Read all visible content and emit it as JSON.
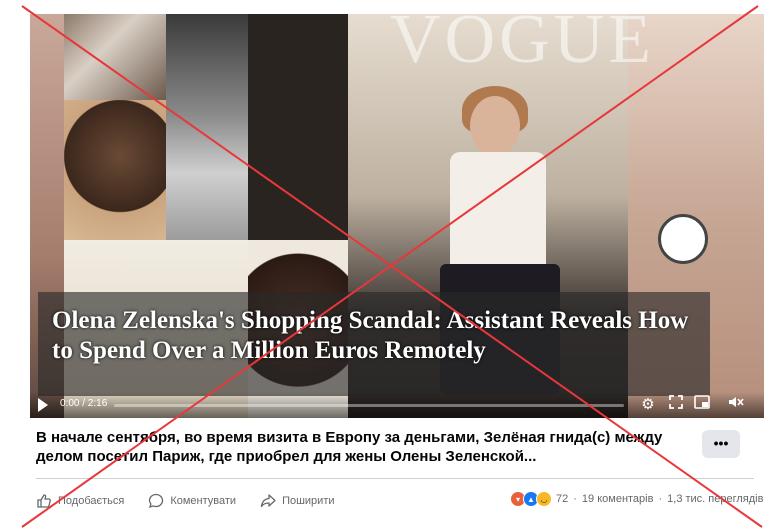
{
  "video": {
    "watermark_text": "VOGUE",
    "overlay_title": "Olena Zelenska's Shopping Scandal: Assistant Reveals How to Spend Over a Million Euros Remotely",
    "time": "0:00 / 2:16",
    "progress_fraction": 0.0
  },
  "post": {
    "caption": "В начале сентября, во время визита в Европу за деньгами, Зелёная гнида(с) между делом посетил Париж, где приобрел для жены Олены Зеленской...",
    "more_label": "•••"
  },
  "actions": {
    "like_label": "Подобається",
    "comment_label": "Коментувати",
    "share_label": "Поширити"
  },
  "stats": {
    "reactions_count": "72",
    "comments": "19 коментарів",
    "views": "1,3 тис. переглядів",
    "separator": "·"
  },
  "colors": {
    "cross_mark": "#e8373a",
    "reaction_angry": "#e8613a",
    "reaction_like": "#1877f2",
    "reaction_laugh": "#f7b928"
  },
  "icons": [
    "play-icon",
    "settings-icon",
    "fullscreen-expand-icon",
    "picture-in-picture-icon",
    "volume-muted-icon",
    "thumbs-up-icon",
    "comment-icon",
    "share-icon",
    "more-icon"
  ]
}
